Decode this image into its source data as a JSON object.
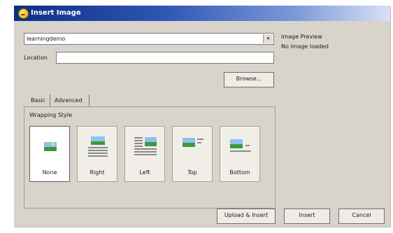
{
  "window": {
    "title": "Insert Image",
    "icon": "smiley-icon"
  },
  "source_combo": {
    "value": "learningdemo",
    "arrow": "▾"
  },
  "location": {
    "label": "Location",
    "value": ""
  },
  "browse_label": "Browse...",
  "tabs": [
    {
      "label": "Basic",
      "selected": true
    },
    {
      "label": "Advanced",
      "selected": false
    }
  ],
  "wrapping": {
    "label": "Wrapping Style",
    "options": [
      {
        "label": "None",
        "icon": "wrap-none-icon",
        "selected": true
      },
      {
        "label": "Right",
        "icon": "wrap-right-icon",
        "selected": false
      },
      {
        "label": "Left",
        "icon": "wrap-left-icon",
        "selected": false
      },
      {
        "label": "Top",
        "icon": "wrap-top-icon",
        "selected": false
      },
      {
        "label": "Bottom",
        "icon": "wrap-bottom-icon",
        "selected": false
      }
    ]
  },
  "preview": {
    "label": "Image Preview",
    "status": "No image loaded"
  },
  "buttons": {
    "upload_insert": "Upload & Insert",
    "insert": "Insert",
    "cancel": "Cancel"
  }
}
